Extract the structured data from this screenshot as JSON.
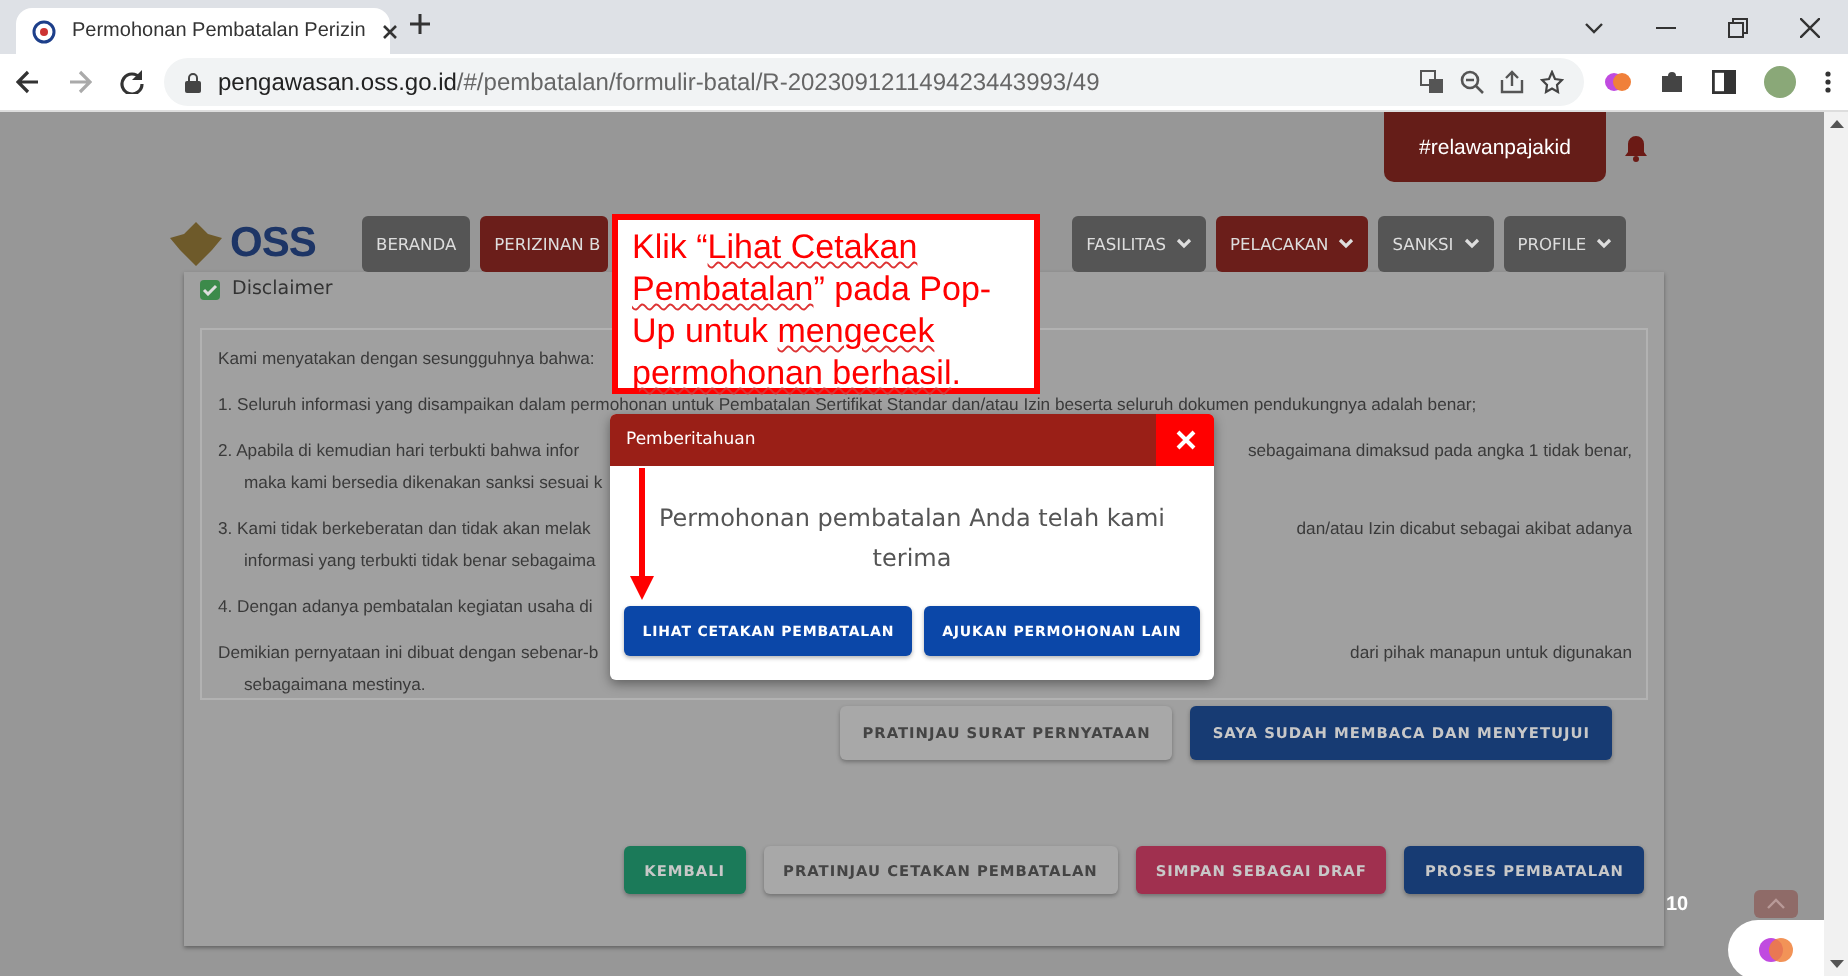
{
  "browser": {
    "tab_title": "Permohonan Pembatalan Perizin",
    "url_host": "pengawasan.oss.go.id",
    "url_path": "/#/pembatalan/formulir-batal/R-202309121149423443993/49"
  },
  "header": {
    "hashtag": "#relawanpajakid",
    "logo_text": "OSS"
  },
  "nav": [
    {
      "label": "BERANDA",
      "color": "#555555",
      "dropdown": false
    },
    {
      "label": "PERIZINAN B",
      "color": "#6b1e1a",
      "dropdown": false
    },
    {
      "label": "FASILITAS",
      "color": "#555555",
      "dropdown": true
    },
    {
      "label": "PELACAKAN",
      "color": "#6b1e1a",
      "dropdown": true
    },
    {
      "label": "SANKSI",
      "color": "#555555",
      "dropdown": true
    },
    {
      "label": "PROFILE",
      "color": "#555555",
      "dropdown": true
    }
  ],
  "disclaimer": {
    "checked": true,
    "label": "Disclaimer",
    "paragraphs": [
      {
        "lines": [
          {
            "kind": "full",
            "text": "Kami menyatakan dengan sesungguhnya bahwa:"
          }
        ]
      },
      {
        "lines": [
          {
            "kind": "full",
            "text": "1.  Seluruh informasi yang disampaikan dalam permohonan untuk Pembatalan Sertifikat Standar dan/atau Izin beserta seluruh dokumen pendukungnya adalah benar;"
          }
        ]
      },
      {
        "lines": [
          {
            "kind": "split",
            "left": "2.  Apabila di kemudian hari terbukti bahwa infor",
            "right": "sebagaimana dimaksud pada angka 1 tidak benar,"
          },
          {
            "kind": "split",
            "left": "maka kami bersedia dikenakan sanksi sesuai k"
          }
        ]
      },
      {
        "lines": [
          {
            "kind": "split",
            "left": "3.  Kami tidak berkeberatan dan tidak akan melak",
            "right": "dan/atau Izin dicabut sebagai akibat adanya"
          },
          {
            "kind": "split",
            "left": "informasi yang terbukti tidak benar sebagaima"
          }
        ]
      },
      {
        "lines": [
          {
            "kind": "split",
            "left": "4.  Dengan adanya pembatalan kegiatan usaha di"
          }
        ]
      },
      {
        "lines": [
          {
            "kind": "split",
            "left": "Demikian pernyataan ini dibuat dengan sebenar-b",
            "right": "dari pihak manapun untuk digunakan"
          },
          {
            "kind": "split",
            "left": "sebagaimana mestinya."
          }
        ]
      }
    ]
  },
  "statement_buttons": [
    {
      "label": "PRATINJAU SURAT PERNYATAAN",
      "color": "#a8a8a8"
    },
    {
      "label": "SAYA SUDAH MEMBACA DAN MENYETUJUI",
      "color": "#173b73"
    }
  ],
  "form_buttons": [
    {
      "label": "KEMBALI",
      "color": "#1b7a59"
    },
    {
      "label": "PRATINJAU CETAKAN PEMBATALAN",
      "color": "#a8a8a8"
    },
    {
      "label": "SIMPAN SEBAGAI DRAF",
      "color": "#a0304f"
    },
    {
      "label": "PROSES PEMBATALAN",
      "color": "#173b73"
    }
  ],
  "page_number": "10",
  "modal": {
    "title": "Pemberitahuan",
    "message": "Permohonan pembatalan Anda telah kami terima",
    "buttons": [
      "LIHAT CETAKAN PEMBATALAN",
      "AJUKAN PERMOHONAN LAIN"
    ]
  },
  "callout": {
    "segments": [
      {
        "text": "Klik “",
        "underlined": false
      },
      {
        "text": "Lihat Cetakan Pembatalan",
        "underlined": true
      },
      {
        "text": "” pada Pop-Up untuk ",
        "underlined": false
      },
      {
        "text": "mengecek ",
        "underlined": true
      },
      {
        "text": "permohonan berhasil",
        "underlined": true
      },
      {
        "text": ".",
        "underlined": false
      }
    ]
  }
}
